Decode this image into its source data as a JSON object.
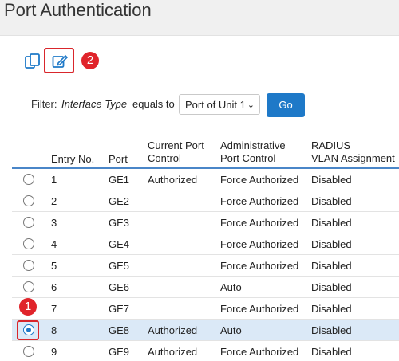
{
  "page": {
    "title": "Port Authentication"
  },
  "toolbar": {
    "copy_icon": "copy-settings-icon",
    "edit_icon": "edit-icon"
  },
  "callouts": {
    "one": "1",
    "two": "2"
  },
  "filter": {
    "label": "Filter:",
    "field": "Interface Type",
    "operator": "equals to",
    "selected_value": "Port of Unit 1",
    "go_label": "Go"
  },
  "table": {
    "headers": {
      "entry": "Entry No.",
      "port": "Port",
      "current_line1": "Current Port",
      "current_line2": "Control",
      "admin_line1": "Administrative",
      "admin_line2": "Port Control",
      "radius_line1": "RADIUS",
      "radius_line2": "VLAN Assignment"
    },
    "rows": [
      {
        "entry": "1",
        "port": "GE1",
        "current": "Authorized",
        "admin": "Force Authorized",
        "radius": "Disabled",
        "selected": false
      },
      {
        "entry": "2",
        "port": "GE2",
        "current": "",
        "admin": "Force Authorized",
        "radius": "Disabled",
        "selected": false
      },
      {
        "entry": "3",
        "port": "GE3",
        "current": "",
        "admin": "Force Authorized",
        "radius": "Disabled",
        "selected": false
      },
      {
        "entry": "4",
        "port": "GE4",
        "current": "",
        "admin": "Force Authorized",
        "radius": "Disabled",
        "selected": false
      },
      {
        "entry": "5",
        "port": "GE5",
        "current": "",
        "admin": "Force Authorized",
        "radius": "Disabled",
        "selected": false
      },
      {
        "entry": "6",
        "port": "GE6",
        "current": "",
        "admin": "Auto",
        "radius": "Disabled",
        "selected": false
      },
      {
        "entry": "7",
        "port": "GE7",
        "current": "",
        "admin": "Force Authorized",
        "radius": "Disabled",
        "selected": false
      },
      {
        "entry": "8",
        "port": "GE8",
        "current": "Authorized",
        "admin": "Auto",
        "radius": "Disabled",
        "selected": true
      },
      {
        "entry": "9",
        "port": "GE9",
        "current": "Authorized",
        "admin": "Force Authorized",
        "radius": "Disabled",
        "selected": false
      }
    ]
  },
  "colors": {
    "accent": "#1e79c8",
    "highlight": "#d9262c",
    "selected_row": "#dbe9f7"
  }
}
